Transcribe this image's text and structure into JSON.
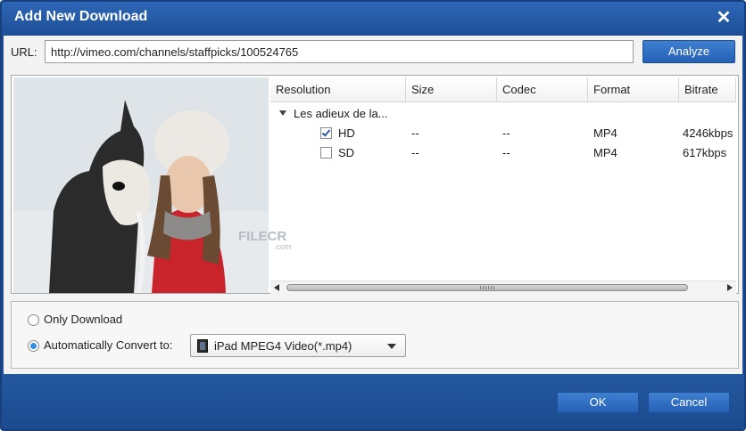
{
  "window": {
    "title": "Add New Download"
  },
  "url": {
    "label": "URL:",
    "value": "http://vimeo.com/channels/staffpicks/100524765"
  },
  "buttons": {
    "analyze": "Analyze",
    "ok": "OK",
    "cancel": "Cancel"
  },
  "list": {
    "columns": [
      "Resolution",
      "Size",
      "Codec",
      "Format",
      "Bitrate"
    ],
    "group_label": "Les adieux de la...",
    "items": [
      {
        "checked": true,
        "resolution": "HD",
        "size": "--",
        "codec": "--",
        "format": "MP4",
        "bitrate": "4246kbps"
      },
      {
        "checked": false,
        "resolution": "SD",
        "size": "--",
        "codec": "--",
        "format": "MP4",
        "bitrate": "617kbps"
      }
    ]
  },
  "options": {
    "only_download": {
      "label": "Only Download",
      "selected": false
    },
    "auto_convert": {
      "label": "Automatically Convert to:",
      "selected": true
    },
    "convert_target": "iPad MPEG4 Video(*.mp4)"
  },
  "watermark": {
    "text": "FILECR",
    "sub": ".com"
  },
  "colors": {
    "titlebar": "#1f4f96",
    "accent_button": "#2f6fc3",
    "radio_selected": "#2f8fe0"
  }
}
